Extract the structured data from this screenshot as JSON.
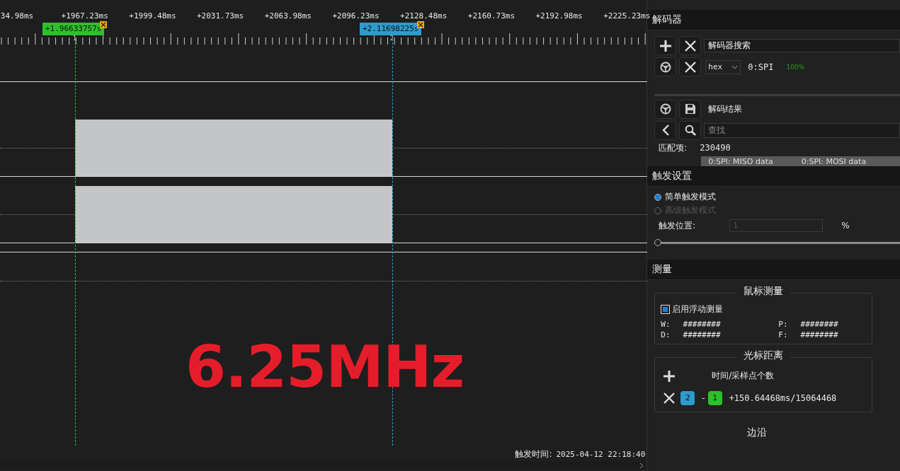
{
  "ruler": {
    "labels": [
      "34.98ms",
      "+1967.23ms",
      "+1999.48ms",
      "+2031.73ms",
      "+2063.98ms",
      "+2096.23ms",
      "+2128.48ms",
      "+2160.73ms",
      "+2192.98ms",
      "+2225.23ms"
    ]
  },
  "cursors": [
    {
      "label": "+1.96633757s",
      "number": "1",
      "color": "#2cc12c"
    },
    {
      "label": "+2.11698225s",
      "number": "2",
      "color": "#2c9ccc"
    }
  ],
  "waveform": {
    "annotation": "6.25MHz"
  },
  "status": {
    "trigger_time_label": "触发时间:",
    "trigger_time": "2025-04-12 22:18:40"
  },
  "decoder_panel": {
    "title": "解码器",
    "search_value": "解码器搜索",
    "decoders": [
      {
        "format": "hex",
        "name": "0:SPI",
        "progress": "100%"
      }
    ]
  },
  "results_panel": {
    "title": "解码结果",
    "search_placeholder": "查找",
    "match_label": "匹配项:",
    "match_count": "230490",
    "columns": [
      "0:SPI: MISO data",
      "0:SPI: MOSI data"
    ]
  },
  "trigger_panel": {
    "title": "触发设置",
    "modes": [
      {
        "label": "简单触发模式",
        "selected": true,
        "disabled": false
      },
      {
        "label": "高级触发模式",
        "selected": false,
        "disabled": true
      }
    ],
    "position_label": "触发位置:",
    "position_value": "1",
    "unit": "%",
    "level": 0
  },
  "measure_panel": {
    "title": "测量",
    "mouse": {
      "title": "鼠标测量",
      "float_label": "启用浮动测量",
      "checked": true,
      "readings": [
        {
          "name": "W:",
          "value": "########"
        },
        {
          "name": "P:",
          "value": "########"
        },
        {
          "name": "D:",
          "value": "########"
        },
        {
          "name": "F:",
          "value": "########"
        }
      ]
    },
    "cursor_distance": {
      "title": "光标距离",
      "header": "时间/采样点个数",
      "from": "2",
      "minus": "-",
      "to": "1",
      "value": "+150.64468ms/15064468"
    },
    "edge_title": "边沿"
  }
}
